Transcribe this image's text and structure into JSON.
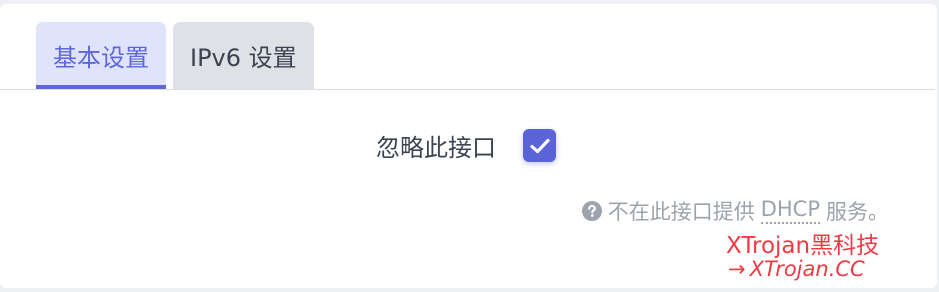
{
  "tabs": [
    {
      "label": "基本设置",
      "active": true
    },
    {
      "label": "IPv6 设置",
      "active": false
    }
  ],
  "field": {
    "label": "忽略此接口",
    "checked": true
  },
  "hint": {
    "icon": "question-circle-icon",
    "before": "不在此接口提供",
    "abbr": "DHCP",
    "after": "服务。"
  },
  "watermark": {
    "title": "XTrojan黑科技",
    "arrow": "→",
    "url": "XTrojan.CC"
  },
  "colors": {
    "accent": "#5b64d6",
    "active_tab_bg": "#dfe3fb",
    "inactive_tab_bg": "#dee2e7",
    "hint_text": "#9da3ad",
    "watermark": "#f03b45"
  }
}
